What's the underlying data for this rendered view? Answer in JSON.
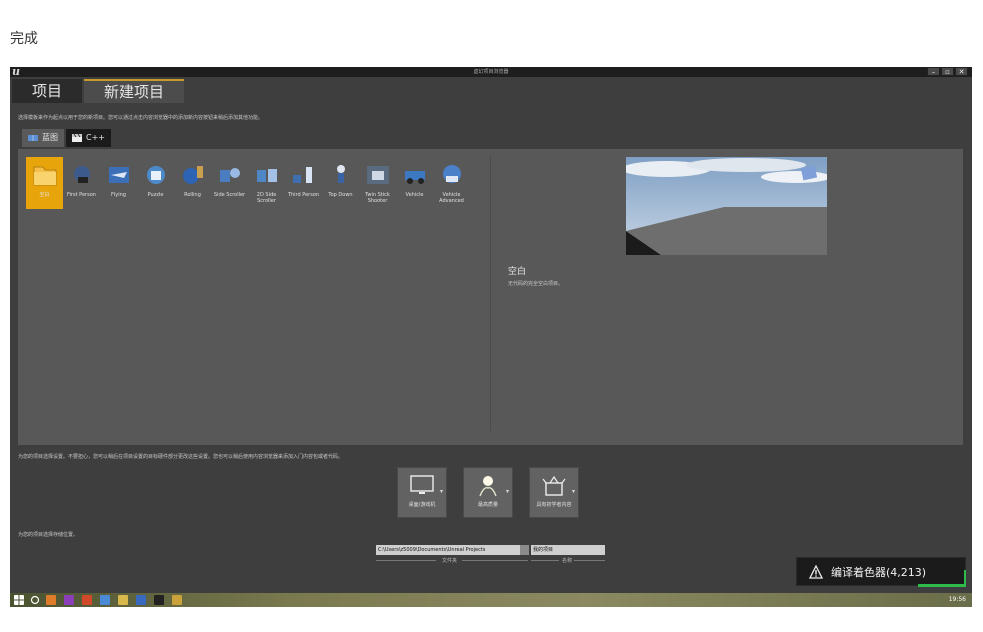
{
  "page": {
    "caption": "完成"
  },
  "window": {
    "title": "虚幻项目浏览器",
    "logo": "u",
    "controls": {
      "minimize": "–",
      "restore": "▫",
      "close": "✕"
    }
  },
  "main_tabs": [
    {
      "label": "项目",
      "active": false
    },
    {
      "label": "新建项目",
      "active": true
    }
  ],
  "template_hint": "选择模板来作为起点以用于您的新项目。您可以通过点击内容浏览器中的添加新内容按钮来稍后添加其他功能。",
  "code_tabs": [
    {
      "label": "蓝图",
      "active": true
    },
    {
      "label": "C++",
      "active": false
    }
  ],
  "templates": [
    {
      "label": "空白",
      "selected": true,
      "icon": "folder-icon",
      "color": "#e8a50b"
    },
    {
      "label": "First Person",
      "icon": "first-person-icon",
      "color": "#3d5a8c"
    },
    {
      "label": "Flying",
      "icon": "flying-icon",
      "color": "#3b6fb8"
    },
    {
      "label": "Puzzle",
      "icon": "puzzle-icon",
      "color": "#4d8ac9"
    },
    {
      "label": "Rolling",
      "icon": "rolling-icon",
      "color": "#2f63b3"
    },
    {
      "label": "Side Scroller",
      "icon": "side-scroller-icon",
      "color": "#4a7cc0"
    },
    {
      "label": "2D Side Scroller",
      "icon": "2d-side-scroller-icon",
      "color": "#4f86c6"
    },
    {
      "label": "Third Person",
      "icon": "third-person-icon",
      "color": "#3f6fb0"
    },
    {
      "label": "Top Down",
      "icon": "top-down-icon",
      "color": "#3a63a5"
    },
    {
      "label": "Twin Stick Shooter",
      "icon": "twin-stick-shooter-icon",
      "color": "#5a6b80"
    },
    {
      "label": "Vehicle",
      "icon": "vehicle-icon",
      "color": "#3d78c2"
    },
    {
      "label": "Vehicle Advanced",
      "icon": "vehicle-advanced-icon",
      "color": "#4a80c8"
    }
  ],
  "preview": {
    "name": "空白",
    "description": "无代码的完全空白项目。"
  },
  "settings_hint": "为您的项目选择设置。不要担心，您可以稍后在项目设置的目标硬件部分更改这些设置。您也可以稍后使用内容浏览器来添加入门内容包或者代码。",
  "settings": [
    {
      "label": "桌面/游戏机",
      "icon": "monitor-icon"
    },
    {
      "label": "最高质量",
      "icon": "quality-icon"
    },
    {
      "label": "具有初学者内容",
      "icon": "starter-content-icon"
    }
  ],
  "location_hint": "为您的项目选择存储位置。",
  "location": {
    "folder_value": "C:\\Users\\z5009\\Documents\\Unreal Projects",
    "folder_caption": "文件夹",
    "name_value": "我的项目",
    "name_caption": "名称"
  },
  "toast": {
    "text": "编译着色器(4,213)",
    "icon": "warning-icon"
  },
  "taskbar": {
    "clock": "19:56"
  }
}
